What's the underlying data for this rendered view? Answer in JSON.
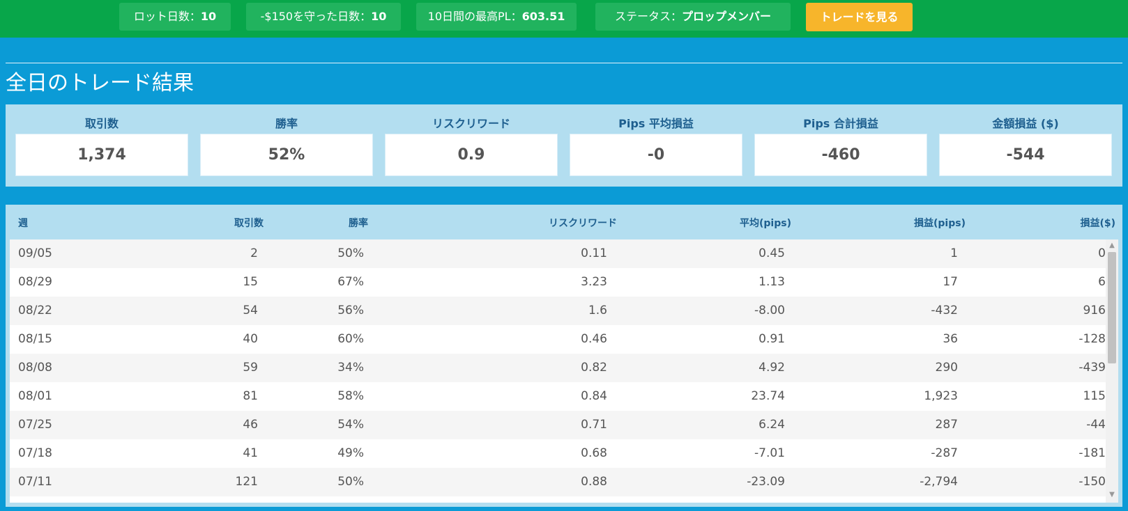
{
  "header": {
    "stats": [
      {
        "label": "ロット日数：",
        "value": "10"
      },
      {
        "label": "-$150を守った日数：",
        "value": "10"
      },
      {
        "label": "10日間の最高PL：",
        "value": "603.51"
      },
      {
        "label": "ステータス：",
        "value": "プロップメンバー"
      }
    ],
    "cta_label": "トレードを見る"
  },
  "page_title": "全日のトレード結果",
  "kpis": [
    {
      "label": "取引数",
      "value": "1,374"
    },
    {
      "label": "勝率",
      "value": "52%"
    },
    {
      "label": "リスクリワード",
      "value": "0.9"
    },
    {
      "label": "Pips 平均損益",
      "value": "-0"
    },
    {
      "label": "Pips 合計損益",
      "value": "-460"
    },
    {
      "label": "金額損益 ($)",
      "value": "-544"
    }
  ],
  "table": {
    "columns": [
      "週",
      "取引数",
      "勝率",
      "リスクリワード",
      "平均(pips)",
      "損益(pips)",
      "損益($)"
    ],
    "rows": [
      [
        "09/05",
        "2",
        "50%",
        "0.11",
        "0.45",
        "1",
        "0"
      ],
      [
        "08/29",
        "15",
        "67%",
        "3.23",
        "1.13",
        "17",
        "6"
      ],
      [
        "08/22",
        "54",
        "56%",
        "1.6",
        "-8.00",
        "-432",
        "916"
      ],
      [
        "08/15",
        "40",
        "60%",
        "0.46",
        "0.91",
        "36",
        "-128"
      ],
      [
        "08/08",
        "59",
        "34%",
        "0.82",
        "4.92",
        "290",
        "-439"
      ],
      [
        "08/01",
        "81",
        "58%",
        "0.84",
        "23.74",
        "1,923",
        "115"
      ],
      [
        "07/25",
        "46",
        "54%",
        "0.71",
        "6.24",
        "287",
        "-44"
      ],
      [
        "07/18",
        "41",
        "49%",
        "0.68",
        "-7.01",
        "-287",
        "-181"
      ],
      [
        "07/11",
        "121",
        "50%",
        "0.88",
        "-23.09",
        "-2,794",
        "-150"
      ]
    ]
  },
  "scrollbar": {
    "up_icon": "▲",
    "down_icon": "▼"
  },
  "colors": {
    "top_bar": "#08a64a",
    "page_bg": "#0b9bd6",
    "panel": "#b3def0",
    "cta": "#f7b52b",
    "heading_text": "#1e5f8f"
  }
}
